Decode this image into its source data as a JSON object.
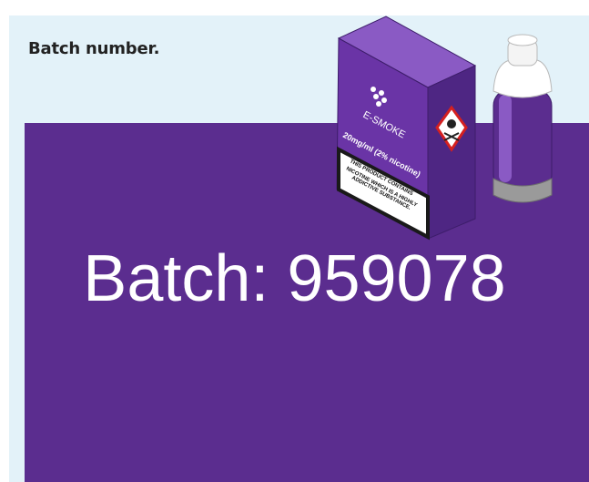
{
  "header": {
    "title": "Batch number."
  },
  "panel": {
    "batch_text": "Batch: 959078"
  },
  "product": {
    "brand": "E-SMOKE",
    "strength": "20mg/ml (2% nicotine)",
    "warning_line1": "THIS PRODUCT CONTAINS",
    "warning_line2": "NICOTINE WHICH IS A HIGHLY",
    "warning_line3": "ADDICTIVE SUBSTANCE."
  },
  "colors": {
    "card_bg": "#e3f2f9",
    "panel_bg": "#5b2d8f",
    "box_front": "#6a34a6",
    "box_side": "#4e2683",
    "box_top": "#8a5ac4"
  }
}
